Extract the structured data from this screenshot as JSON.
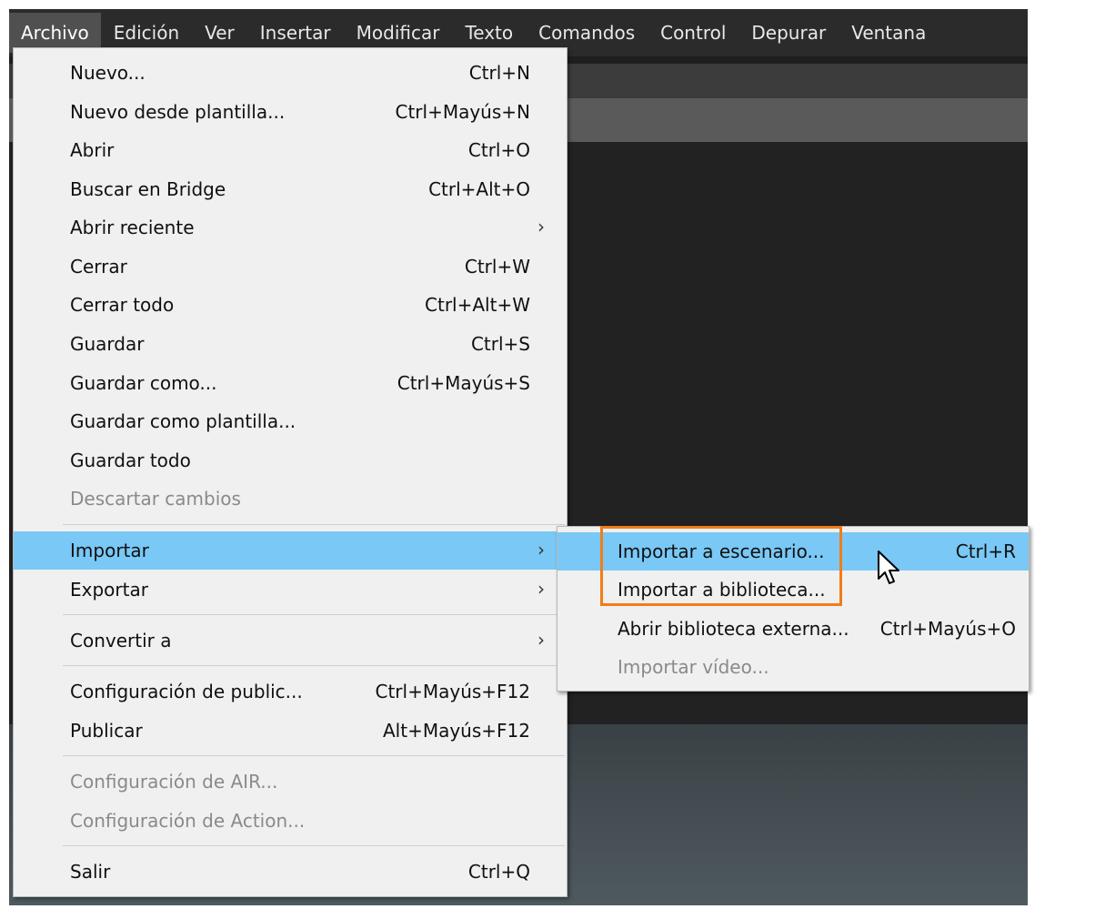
{
  "menubar": {
    "items": [
      "Archivo",
      "Edición",
      "Ver",
      "Insertar",
      "Modificar",
      "Texto",
      "Comandos",
      "Control",
      "Depurar",
      "Ventana"
    ]
  },
  "file_menu": {
    "items": [
      {
        "label": "Nuevo...",
        "shortcut": "Ctrl+N"
      },
      {
        "label": "Nuevo desde plantilla...",
        "shortcut": "Ctrl+Mayús+N"
      },
      {
        "label": "Abrir",
        "shortcut": "Ctrl+O"
      },
      {
        "label": "Buscar en Bridge",
        "shortcut": "Ctrl+Alt+O"
      },
      {
        "label": "Abrir reciente",
        "shortcut": "",
        "submenu": true
      },
      {
        "label": "Cerrar",
        "shortcut": "Ctrl+W"
      },
      {
        "label": "Cerrar todo",
        "shortcut": "Ctrl+Alt+W"
      },
      {
        "label": "Guardar",
        "shortcut": "Ctrl+S"
      },
      {
        "label": "Guardar como...",
        "shortcut": "Ctrl+Mayús+S"
      },
      {
        "label": "Guardar como plantilla...",
        "shortcut": ""
      },
      {
        "label": "Guardar todo",
        "shortcut": ""
      },
      {
        "label": "Descartar cambios",
        "shortcut": "",
        "disabled": true
      },
      {
        "label": "Importar",
        "shortcut": "",
        "submenu": true,
        "highlighted": true
      },
      {
        "label": "Exportar",
        "shortcut": "",
        "submenu": true
      },
      {
        "label": "Convertir a",
        "shortcut": "",
        "submenu": true
      },
      {
        "label": "Configuración de public...",
        "shortcut": "Ctrl+Mayús+F12"
      },
      {
        "label": "Publicar",
        "shortcut": "Alt+Mayús+F12"
      },
      {
        "label": "Configuración de AIR...",
        "shortcut": "",
        "disabled": true
      },
      {
        "label": "Configuración de Action...",
        "shortcut": "",
        "disabled": true
      },
      {
        "label": "Salir",
        "shortcut": "Ctrl+Q"
      }
    ]
  },
  "import_submenu": {
    "items": [
      {
        "label": "Importar a escenario...",
        "shortcut": "Ctrl+R",
        "highlighted": true
      },
      {
        "label": "Importar a biblioteca...",
        "shortcut": ""
      },
      {
        "label": "Abrir biblioteca externa...",
        "shortcut": "Ctrl+Mayús+O"
      },
      {
        "label": "Importar vídeo...",
        "shortcut": "",
        "disabled": true
      }
    ]
  },
  "colors": {
    "highlight": "#79c8f5",
    "focus_box": "#f07d18",
    "menu_bg": "#f0f0f0",
    "menubar_bg": "#2b2b2b"
  },
  "submenu_arrow": "›"
}
